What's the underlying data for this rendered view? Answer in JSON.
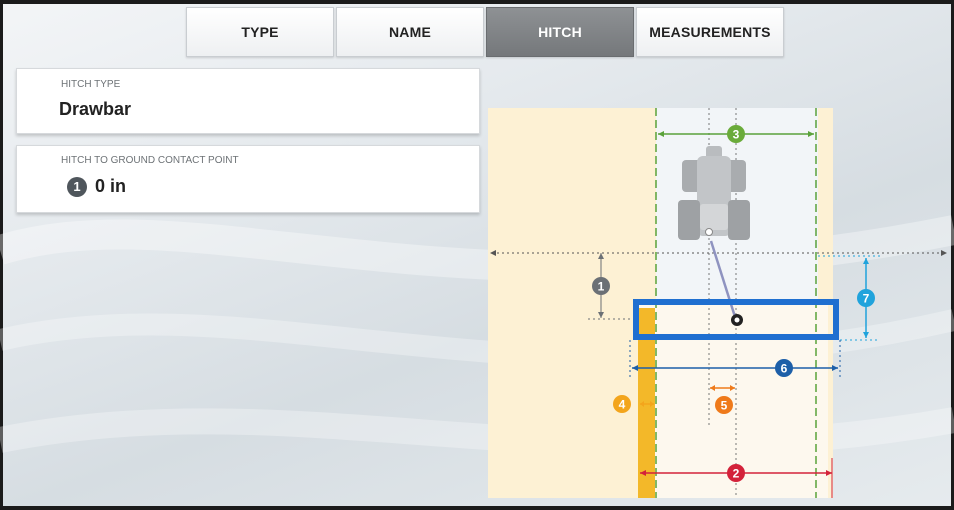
{
  "tabs": [
    {
      "label": "TYPE",
      "active": false
    },
    {
      "label": "NAME",
      "active": false
    },
    {
      "label": "HITCH",
      "active": true
    },
    {
      "label": "MEASUREMENTS",
      "active": false
    }
  ],
  "hitch_type": {
    "label": "HITCH TYPE",
    "value": "Drawbar"
  },
  "hitch_contact": {
    "label": "HITCH TO GROUND CONTACT POINT",
    "badge": "1",
    "value": "0 in"
  },
  "diagram": {
    "markers": [
      "1",
      "2",
      "3",
      "4",
      "5",
      "6",
      "7"
    ],
    "colors": {
      "marker_1": "#6b7075",
      "marker_2": "#d3223a",
      "marker_3": "#6aab3a",
      "marker_4": "#f3a51c",
      "marker_5": "#ef7a1a",
      "marker_6": "#1d5fa8",
      "marker_7": "#20a3dc",
      "implement": "#1f6fd0"
    }
  }
}
